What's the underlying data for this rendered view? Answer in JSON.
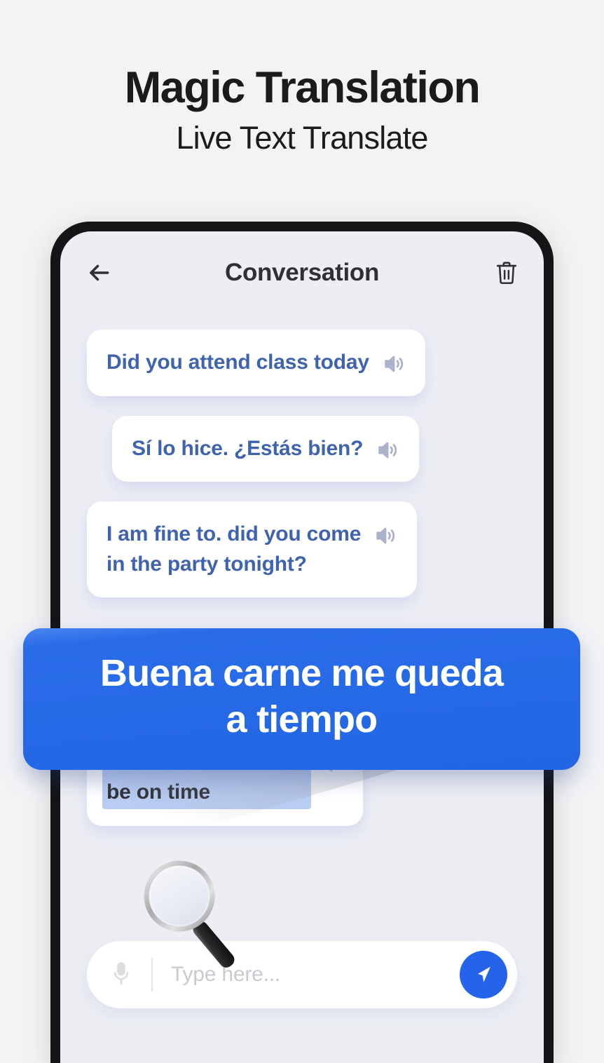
{
  "promo": {
    "title": "Magic Translation",
    "subtitle": "Live Text Translate"
  },
  "app": {
    "bar": {
      "back_label": "Back",
      "title": "Conversation",
      "delete_label": "Delete conversation"
    },
    "messages": [
      {
        "text": "Did you attend class today",
        "speaker_label": "Play audio",
        "selected": false
      },
      {
        "text": "Sí lo hice. ¿Estás bien?",
        "speaker_label": "Play audio",
        "selected": false
      },
      {
        "text": "I am fine to. did you come\nin the party tonight?",
        "speaker_label": "Play audio",
        "selected": false
      },
      {
        "text": "Good meat me there\nbe on time",
        "speaker_label": "Play audio",
        "selected": true
      }
    ],
    "input": {
      "mic_label": "Voice input",
      "placeholder": "Type here...",
      "value": "",
      "send_label": "Send"
    }
  },
  "callout": {
    "text": "Buena carne me queda\na tiempo"
  },
  "colors": {
    "page_background": "#f2f3f5",
    "phone_bezel": "#151517",
    "screen_background": "#edeef4",
    "bubble_background": "#ffffff",
    "bubble_text": "#3f63ad",
    "selection_highlight": "#b9cdf3",
    "selected_text": "#2f3036",
    "accent_blue": "#2563eb",
    "callout_blue": "#2266e4",
    "speaker_icon": "#aab2cc",
    "placeholder_text": "#c8cacf"
  }
}
